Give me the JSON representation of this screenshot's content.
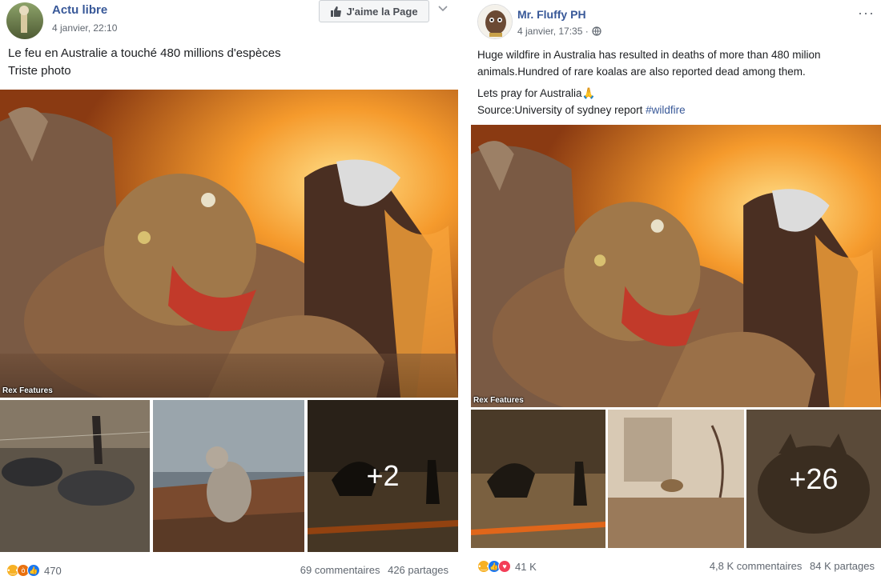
{
  "left_post": {
    "page_name": "Actu libre",
    "timestamp": "4 janvier, 22:10",
    "like_page_label": "J'aime la Page",
    "text_line1": "Le feu en Australie a touché 480 millions d'espèces",
    "text_line2": "Triste photo",
    "photo_credit": "Rex Features",
    "more_photos": "+2",
    "reaction_count": "470",
    "comments": "69 commentaires",
    "shares": "426 partages"
  },
  "right_post": {
    "page_name": "Mr. Fluffy PH",
    "timestamp": "4 janvier, 17:35 ·",
    "text_line1": "Huge wildfire in Australia has resulted in deaths of more than 480 milion",
    "text_line2": "animals.Hundred of rare koalas are also reported dead among them.",
    "text_line3": "Lets pray for Australia",
    "text_line3_emoji": "🙏",
    "source_prefix": "Source:University of sydney report ",
    "hashtag": "#wildfire",
    "photo_credit": "Rex Features",
    "more_photos": "+26",
    "reaction_count": "41 K",
    "comments": "4,8 K commentaires",
    "shares": "84 K partages",
    "more_options": "···"
  },
  "colors": {
    "link": "#385898",
    "fire_orange": "#f08a24",
    "like_blue": "#1877f2",
    "love_red": "#f33e58",
    "sad_yellow": "#f7b125"
  }
}
